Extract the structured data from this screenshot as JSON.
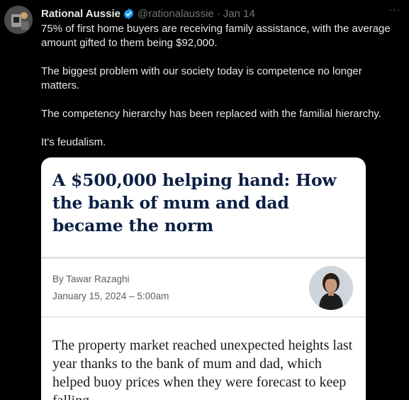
{
  "tweet": {
    "author_name": "Rational Aussie",
    "handle": "@rationalaussie",
    "separator": "·",
    "date": "Jan 14",
    "more_label": "···",
    "paragraphs": [
      "75% of first home buyers are receiving family assistance, with the average amount gifted to them being $92,000.",
      "The biggest problem with our society today is competence no longer matters.",
      "The competency hierarchy has been replaced with the familial hierarchy.",
      "It's feudalism."
    ]
  },
  "card": {
    "headline": "A $500,000 helping hand: How the bank of mum and dad became the norm",
    "byline": "By Tawar Razaghi",
    "date": "January 15, 2024 – 5:00am",
    "body": "The property market reached unexpected heights last year thanks to the bank of mum and dad, which helped buoy prices when they were forecast to keep falling."
  },
  "colors": {
    "background": "#000000",
    "text_primary": "#e7e9ea",
    "text_secondary": "#71767b",
    "verified_blue": "#1d9bf0",
    "headline_navy": "#0a1f44"
  },
  "icons": {
    "verified": "verified-badge-icon",
    "more": "more-horizontal-icon"
  }
}
